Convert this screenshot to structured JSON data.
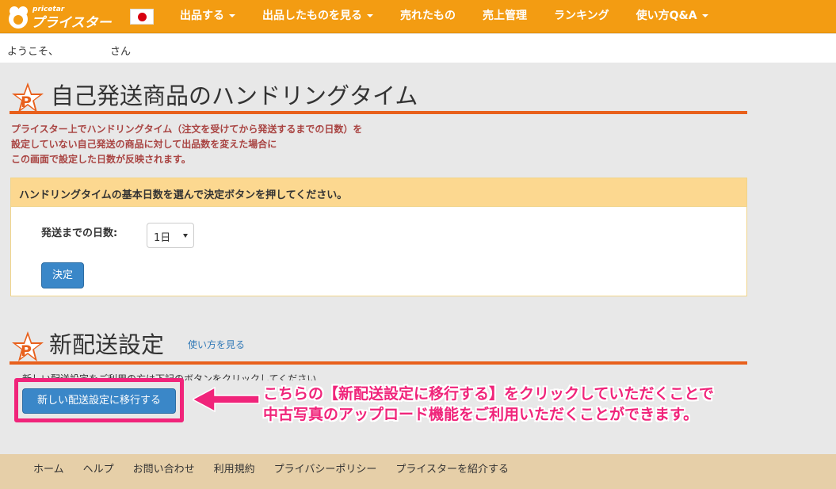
{
  "brand": {
    "logo_text": "プライスター",
    "logo_sub": "pricetar"
  },
  "nav": {
    "items": [
      {
        "label": "出品する",
        "dropdown": true
      },
      {
        "label": "出品したものを見る",
        "dropdown": true
      },
      {
        "label": "売れたもの",
        "dropdown": false
      },
      {
        "label": "売上管理",
        "dropdown": false
      },
      {
        "label": "ランキング",
        "dropdown": false
      },
      {
        "label": "使い方Q&A",
        "dropdown": true
      }
    ]
  },
  "welcome": {
    "prefix": "ようこそ、",
    "suffix": "さん"
  },
  "handling": {
    "title": "自己発送商品のハンドリングタイム",
    "desc_lines": [
      "プライスター上でハンドリングタイム（注文を受けてから発送するまでの日数）を",
      "設定していない自己発送の商品に対して出品数を変えた場合に",
      "この画面で設定した日数が反映されます。"
    ],
    "panel_heading": "ハンドリングタイムの基本日数を選んで決定ボタンを押してください。",
    "field_label": "発送までの日数:",
    "select_value": "1日",
    "submit_label": "決定"
  },
  "shipping": {
    "title": "新配送設定",
    "howto_link": "使い方を見る",
    "instruction": "新しい配送設定をご利用の方は下記のボタンをクリックしてください",
    "button_label": "新しい配送設定に移行する"
  },
  "callout": {
    "line1": "こちらの【新配送設定に移行する】をクリックしていただくことで",
    "line2": "中古写真のアップロード機能をご利用いただくことができます。"
  },
  "footer": {
    "links": [
      "ホーム",
      "ヘルプ",
      "お問い合わせ",
      "利用規約",
      "プライバシーポリシー",
      "プライスターを紹介する"
    ]
  },
  "colors": {
    "navbar": "#f39c12",
    "accent_line": "#e8601c",
    "desc_text": "#a94442",
    "panel_head": "#fcd890",
    "button": "#3a87c8",
    "highlight": "#f0247a",
    "footer": "#e6cfa8"
  }
}
